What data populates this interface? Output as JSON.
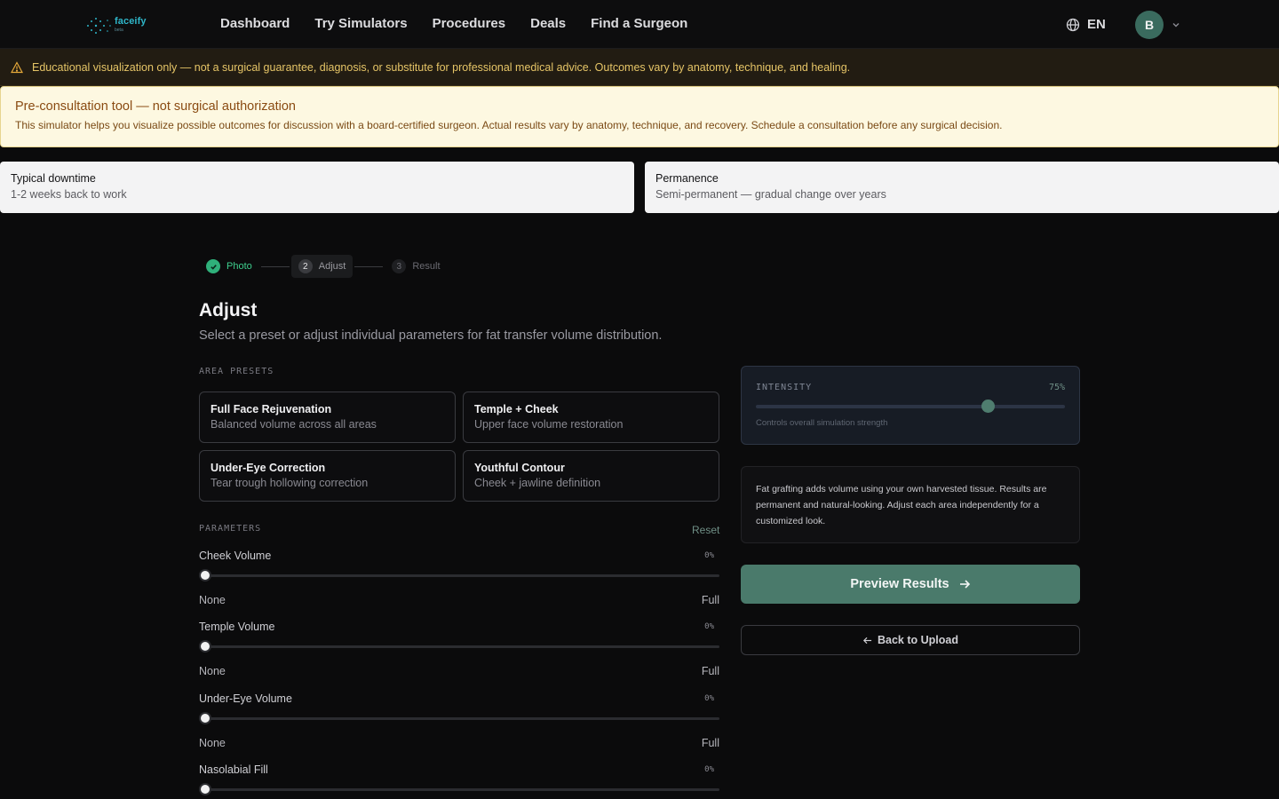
{
  "brand": {
    "name": "faceify",
    "tagline": "beta"
  },
  "nav": {
    "links": [
      "Dashboard",
      "Try Simulators",
      "Procedures",
      "Deals",
      "Find a Surgeon"
    ],
    "language": "EN",
    "avatar_initial": "B"
  },
  "disclaimer": "Educational visualization only — not a surgical guarantee, diagnosis, or substitute for professional medical advice. Outcomes vary by anatomy, technique, and healing.",
  "preconsult": {
    "title": "Pre-consultation tool — not surgical authorization",
    "body": "This simulator helps you visualize possible outcomes for discussion with a board-certified surgeon. Actual results vary by anatomy, technique, and recovery. Schedule a consultation before any surgical decision."
  },
  "info_cards": [
    {
      "label": "Typical downtime",
      "value": "1-2 weeks back to work"
    },
    {
      "label": "Permanence",
      "value": "Semi-permanent — gradual change over years"
    }
  ],
  "stepper": [
    {
      "label": "Photo",
      "state": "done",
      "number": ""
    },
    {
      "label": "Adjust",
      "state": "active",
      "number": "2"
    },
    {
      "label": "Result",
      "state": "todo",
      "number": "3"
    }
  ],
  "page": {
    "title": "Adjust",
    "subtitle": "Select a preset or adjust individual parameters for fat transfer volume distribution."
  },
  "presets": {
    "section_label": "AREA PRESETS",
    "items": [
      {
        "title": "Full Face Rejuvenation",
        "subtitle": "Balanced volume across all areas"
      },
      {
        "title": "Temple + Cheek",
        "subtitle": "Upper face volume restoration"
      },
      {
        "title": "Under-Eye Correction",
        "subtitle": "Tear trough hollowing correction"
      },
      {
        "title": "Youthful Contour",
        "subtitle": "Cheek + jawline definition"
      }
    ]
  },
  "parameters": {
    "section_label": "PARAMETERS",
    "reset_label": "Reset",
    "items": [
      {
        "name": "Cheek Volume",
        "value": "0%",
        "level": 0,
        "min_label": "None",
        "max_label": "Full"
      },
      {
        "name": "Temple Volume",
        "value": "0%",
        "level": 0,
        "min_label": "None",
        "max_label": "Full"
      },
      {
        "name": "Under-Eye Volume",
        "value": "0%",
        "level": 0,
        "min_label": "None",
        "max_label": "Full"
      },
      {
        "name": "Nasolabial Fill",
        "value": "0%",
        "level": 0,
        "min_label": "",
        "max_label": ""
      }
    ]
  },
  "intensity": {
    "label": "INTENSITY",
    "value": "75%",
    "level": 0.75,
    "hint": "Controls overall simulation strength"
  },
  "note": "Fat grafting adds volume using your own harvested tissue. Results are permanent and natural-looking. Adjust each area independently for a customized look.",
  "buttons": {
    "preview": "Preview Results",
    "back": "Back to Upload"
  },
  "colors": {
    "accent": "#4a7a6b",
    "success": "#2fb07a",
    "warning_text": "#e6c567"
  }
}
